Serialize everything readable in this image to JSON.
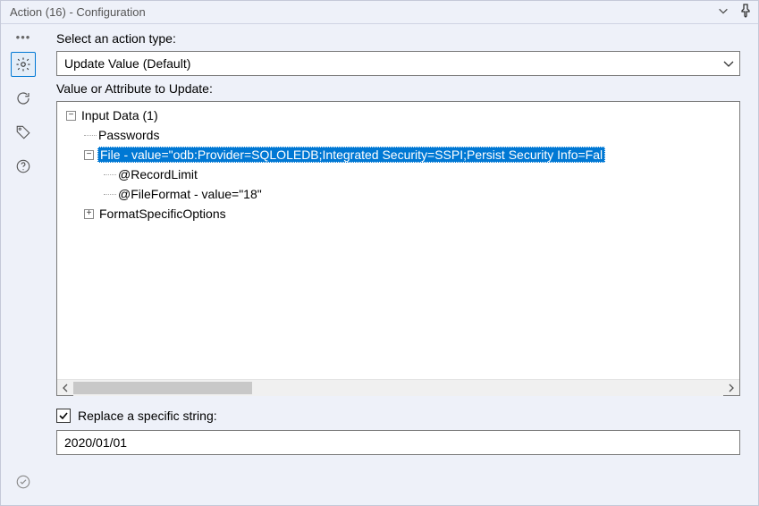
{
  "window": {
    "title": "Action (16) - Configuration"
  },
  "section": {
    "action_type_label": "Select an action type:",
    "action_type_value": "Update Value (Default)",
    "tree_label": "Value or Attribute to Update:",
    "replace_label": "Replace a specific string:",
    "replace_value": "2020/01/01"
  },
  "tree": {
    "root": "Input Data (1)",
    "n_passwords": "Passwords",
    "n_file": "File - value=\"odb:Provider=SQLOLEDB;Integrated Security=SSPI;Persist Security Info=Fal",
    "n_recordlimit": "@RecordLimit",
    "n_fileformat": "@FileFormat - value=\"18\"",
    "n_format": "FormatSpecificOptions"
  }
}
